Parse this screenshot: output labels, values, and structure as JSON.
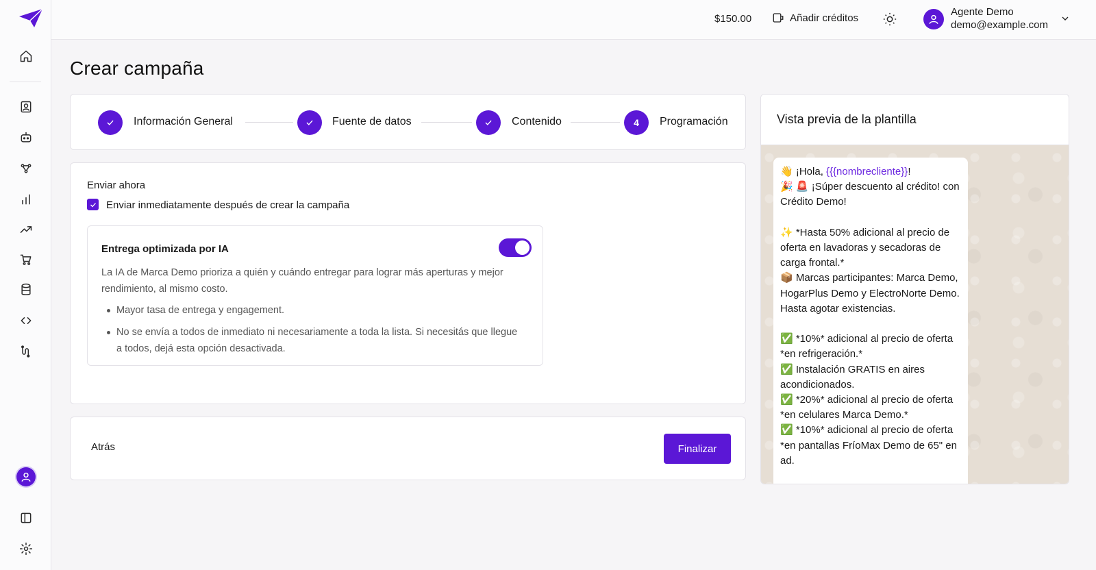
{
  "header": {
    "balance": "$150.00",
    "add_credits_label": "Añadir créditos",
    "user_name": "Agente Demo",
    "user_email": "demo@example.com"
  },
  "page": {
    "title": "Crear campaña"
  },
  "stepper": {
    "steps": [
      {
        "label": "Información General",
        "state": "done"
      },
      {
        "label": "Fuente de datos",
        "state": "done"
      },
      {
        "label": "Contenido",
        "state": "done"
      },
      {
        "label": "Programación",
        "state": "current",
        "number": "4"
      }
    ]
  },
  "schedule": {
    "send_now_title": "Enviar ahora",
    "send_now_checkbox_label": "Enviar inmediatamente después de crear la campaña",
    "send_now_checked": true,
    "ai": {
      "title": "Entrega optimizada por IA",
      "enabled": true,
      "description": "La IA de Marca Demo prioriza a quién y cuándo entregar para lograr más aperturas y mejor rendimiento, al mismo costo.",
      "bullets": [
        "Mayor tasa de entrega y engagement.",
        "No se envía a todos de inmediato ni necesariamente a toda la lista. Si necesitás que llegue a todos, dejá esta opción desactivada."
      ]
    }
  },
  "actions": {
    "back_label": "Atrás",
    "finish_label": "Finalizar"
  },
  "preview": {
    "title": "Vista previa de la plantilla",
    "greeting_prefix": "👋 ¡Hola, ",
    "variable": "{{{nombrecliente}}",
    "greeting_suffix": "!",
    "body": "🎉 🚨 ¡Súper descuento al crédito! con Crédito Demo!\n\n✨ *Hasta 50% adicional al precio de oferta en lavadoras y secadoras de carga frontal.*\n📦 Marcas participantes: Marca Demo, HogarPlus Demo y ElectroNorte Demo. Hasta agotar existencias.\n\n✅ *10%* adicional al precio de oferta *en refrigeración.*\n✅ Instalación GRATIS en aires acondicionados.\n✅ *20%* adicional al precio de oferta *en celulares Marca Demo.*\n✅ *10%* adicional al precio de oferta *en pantallas FríoMax Demo de 65\" en ad."
  },
  "icons": {
    "sidebar": [
      "logo-icon",
      "home-icon",
      "contacts-icon",
      "bot-icon",
      "flows-icon",
      "bar-chart-icon",
      "trending-icon",
      "cart-icon",
      "database-icon",
      "code-icon",
      "integrations-icon",
      "profile-icon",
      "panel-toggle-icon",
      "settings-icon"
    ],
    "accent_color": "#5b17d6"
  }
}
